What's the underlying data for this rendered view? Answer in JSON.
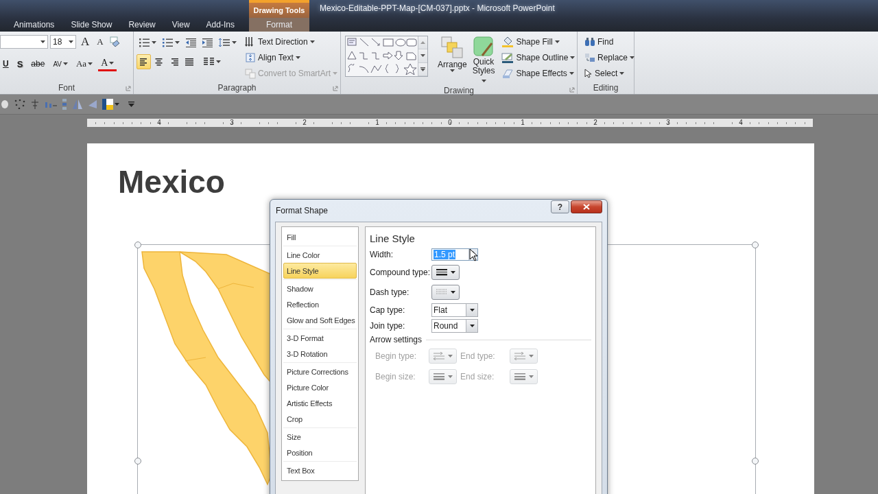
{
  "window": {
    "title": "Mexico-Editable-PPT-Map-[CM-037].pptx - Microsoft PowerPoint"
  },
  "tabs": [
    {
      "kind": "standard",
      "label": "Animations",
      "selected": false
    },
    {
      "kind": "standard",
      "label": "Slide Show",
      "selected": false
    },
    {
      "kind": "standard",
      "label": "Review",
      "selected": false
    },
    {
      "kind": "standard",
      "label": "View",
      "selected": false
    },
    {
      "kind": "standard",
      "label": "Add-Ins",
      "selected": false
    },
    {
      "kind": "contextual",
      "group": "Drawing Tools",
      "label": "Format",
      "selected": true
    }
  ],
  "ribbon": {
    "font": {
      "label": "Font",
      "size": "18",
      "buttons": [
        {
          "kind": "grow",
          "label": "A"
        },
        {
          "kind": "shrink",
          "label": "A"
        },
        {
          "kind": "underline",
          "label": "U"
        },
        {
          "kind": "shadow",
          "label": "S"
        },
        {
          "kind": "strike",
          "label": "abe"
        },
        {
          "kind": "spacing",
          "label": "AV"
        },
        {
          "kind": "case",
          "label": "Aa"
        },
        {
          "kind": "color",
          "label": "A"
        }
      ]
    },
    "paragraph": {
      "label": "Paragraph",
      "alignment": [
        {
          "kind": "left",
          "selected": true
        },
        {
          "kind": "center",
          "selected": false
        },
        {
          "kind": "right",
          "selected": false
        },
        {
          "kind": "justify",
          "selected": false
        }
      ],
      "commands": [
        {
          "kind": "direction",
          "label": "Text Direction",
          "disabled": false
        },
        {
          "kind": "align",
          "label": "Align Text",
          "disabled": false
        },
        {
          "kind": "smartart",
          "label": "Convert to SmartArt",
          "disabled": true
        }
      ]
    },
    "drawing": {
      "label": "Drawing",
      "arrange": "Arrange",
      "quick_styles": "Quick Styles",
      "commands": [
        {
          "kind": "fill",
          "label": "Shape Fill"
        },
        {
          "kind": "outline",
          "label": "Shape Outline"
        },
        {
          "kind": "effects",
          "label": "Shape Effects"
        }
      ]
    },
    "editing": {
      "label": "Editing",
      "commands": [
        {
          "kind": "find",
          "label": "Find"
        },
        {
          "kind": "replace",
          "label": "Replace"
        },
        {
          "kind": "select",
          "label": "Select"
        }
      ]
    }
  },
  "ruler": {
    "labels": [
      "4",
      "3",
      "2",
      "1",
      "0",
      "1",
      "2",
      "3",
      "4"
    ]
  },
  "slide": {
    "title": "Mexico"
  },
  "dialog": {
    "title": "Format Shape",
    "help": "?",
    "category_groups": [
      {
        "items": [
          {
            "label": "Fill",
            "selected": false
          }
        ]
      },
      {
        "items": [
          {
            "label": "Line Color",
            "selected": false
          },
          {
            "label": "Line Style",
            "selected": true
          }
        ]
      },
      {
        "items": [
          {
            "label": "Shadow",
            "selected": false
          },
          {
            "label": "Reflection",
            "selected": false
          },
          {
            "label": "Glow and Soft Edges",
            "selected": false
          }
        ]
      },
      {
        "items": [
          {
            "label": "3-D Format",
            "selected": false
          },
          {
            "label": "3-D Rotation",
            "selected": false
          }
        ]
      },
      {
        "items": [
          {
            "label": "Picture Corrections",
            "selected": false
          },
          {
            "label": "Picture Color",
            "selected": false
          },
          {
            "label": "Artistic Effects",
            "selected": false
          },
          {
            "label": "Crop",
            "selected": false
          }
        ]
      },
      {
        "items": [
          {
            "label": "Size",
            "selected": false
          },
          {
            "label": "Position",
            "selected": false
          }
        ]
      },
      {
        "items": [
          {
            "label": "Text Box",
            "selected": false
          }
        ]
      }
    ],
    "heading": "Line Style",
    "fields": [
      {
        "kind": "spin",
        "label": "Width:",
        "value": "1.5 pt",
        "text_selected": true
      },
      {
        "kind": "compound",
        "label": "Compound type:"
      },
      {
        "kind": "dash",
        "label": "Dash type:"
      },
      {
        "kind": "dropdown",
        "label": "Cap type:",
        "value": "Flat"
      },
      {
        "kind": "dropdown",
        "label": "Join type:",
        "value": "Round"
      }
    ],
    "arrow_settings": {
      "label": "Arrow settings",
      "fields": [
        {
          "kind": "arrow_type",
          "label": "Begin type:",
          "disabled": true
        },
        {
          "kind": "arrow_type",
          "label": "End type:",
          "disabled": true
        },
        {
          "kind": "arrow_size",
          "label": "Begin size:",
          "disabled": true
        },
        {
          "kind": "arrow_size",
          "label": "End size:",
          "disabled": true
        }
      ]
    }
  }
}
